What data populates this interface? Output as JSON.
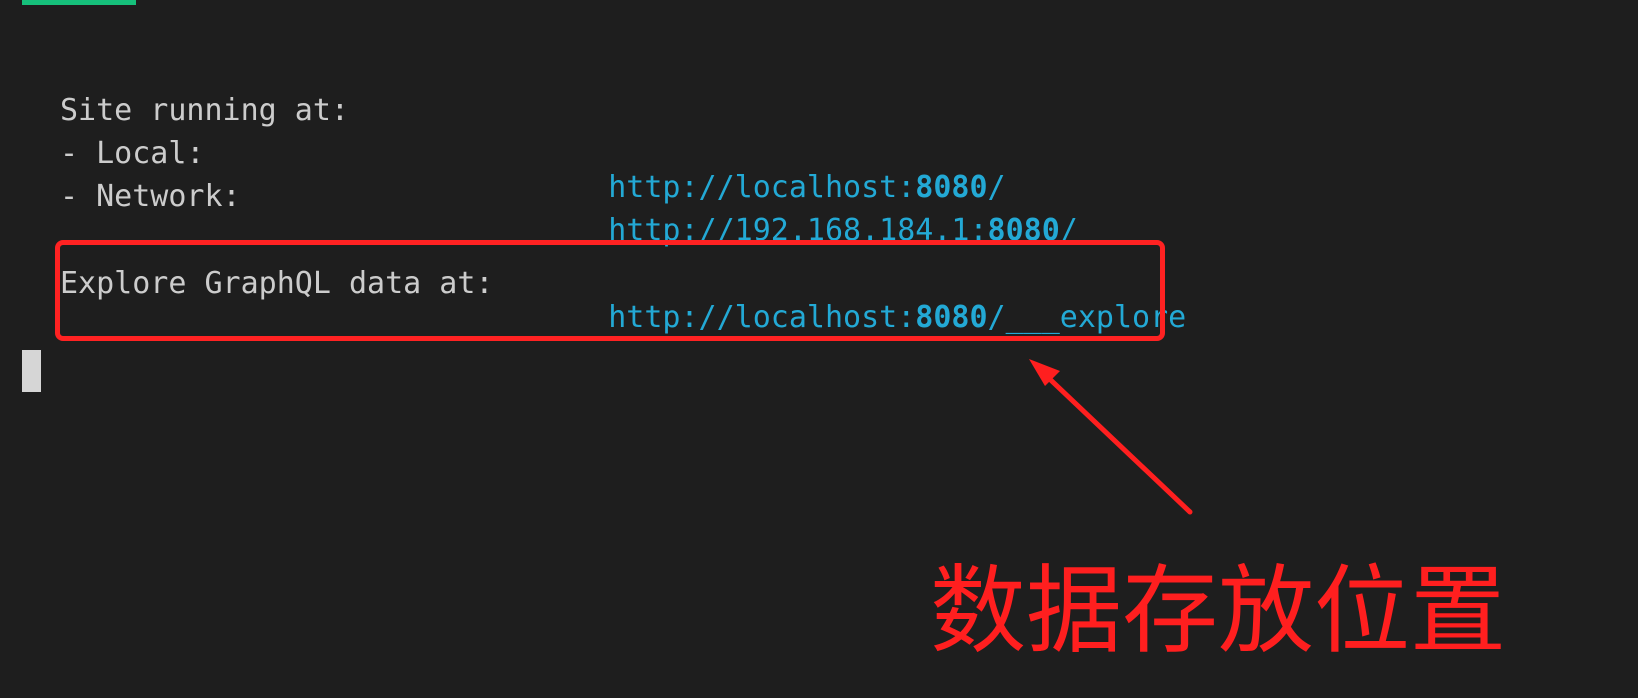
{
  "terminal": {
    "site_running_label": "Site running at:",
    "local_label": "- Local:",
    "local_url_prefix": "http://localhost:",
    "local_port": "8080",
    "local_url_suffix": "/",
    "network_label": "- Network:",
    "network_url_prefix": "http://192.168.184.1:",
    "network_port": "8080",
    "network_url_suffix": "/",
    "graphql_label": "Explore GraphQL data at:",
    "graphql_url_prefix": "http://localhost:",
    "graphql_port": "8080",
    "graphql_url_suffix": "/___explore"
  },
  "annotation": {
    "text": "数据存放位置"
  },
  "colors": {
    "background": "#1e1e1e",
    "text": "#cccccc",
    "url": "#23a9d5",
    "annotation": "#ff1f1f",
    "top_accent": "#16c07b",
    "cursor": "#d6d6d6"
  },
  "icons": {
    "cursor": "terminal-cursor-block",
    "arrow": "annotation-arrow"
  }
}
